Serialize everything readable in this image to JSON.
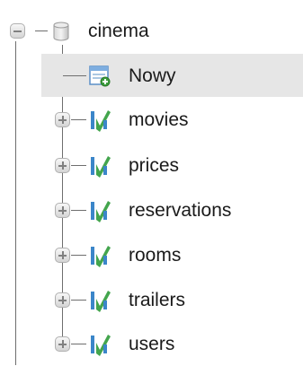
{
  "database": {
    "name": "cinema",
    "expanded": true,
    "icon": "database-icon"
  },
  "new_item": {
    "label": "Nowy",
    "icon": "new-table-icon"
  },
  "tables": [
    {
      "name": "movies",
      "icon": "table-icon"
    },
    {
      "name": "prices",
      "icon": "table-icon"
    },
    {
      "name": "reservations",
      "icon": "table-icon"
    },
    {
      "name": "rooms",
      "icon": "table-icon"
    },
    {
      "name": "trailers",
      "icon": "table-icon"
    },
    {
      "name": "users",
      "icon": "table-icon"
    }
  ],
  "colors": {
    "table_icon_blue": "#3b86c9",
    "table_icon_green": "#2f9b3a",
    "selected_bg": "#e6e6e6"
  }
}
